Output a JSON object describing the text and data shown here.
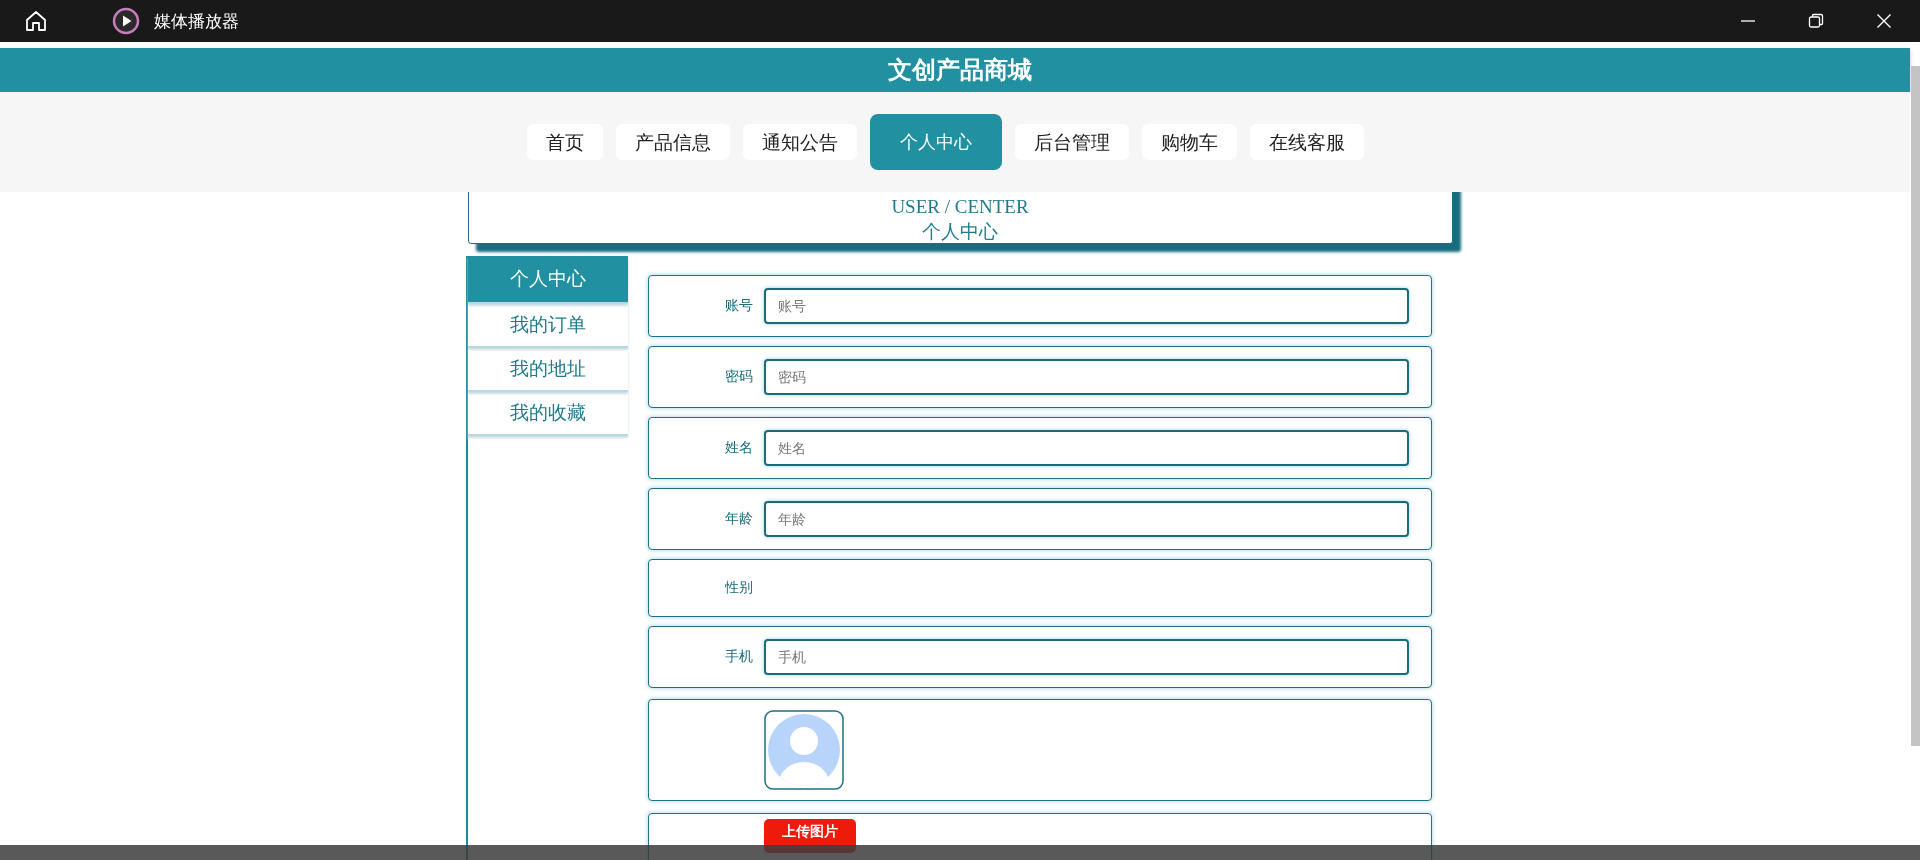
{
  "titlebar": {
    "title": "媒体播放器"
  },
  "site": {
    "title": "文创产品商城"
  },
  "nav": [
    {
      "label": "首页",
      "selected": false
    },
    {
      "label": "产品信息",
      "selected": false
    },
    {
      "label": "通知公告",
      "selected": false
    },
    {
      "label": "个人中心",
      "selected": true
    },
    {
      "label": "后台管理",
      "selected": false
    },
    {
      "label": "购物车",
      "selected": false
    },
    {
      "label": "在线客服",
      "selected": false
    }
  ],
  "banner": {
    "english": "USER / CENTER",
    "title": "个人中心"
  },
  "side_menu": [
    {
      "label": "个人中心",
      "selected": true
    },
    {
      "label": "我的订单",
      "selected": false
    },
    {
      "label": "我的地址",
      "selected": false
    },
    {
      "label": "我的收藏",
      "selected": false
    }
  ],
  "form": [
    {
      "kind": "text",
      "label": "账号",
      "placeholder": "账号"
    },
    {
      "kind": "text",
      "label": "密码",
      "placeholder": "密码"
    },
    {
      "kind": "text",
      "label": "姓名",
      "placeholder": "姓名"
    },
    {
      "kind": "text",
      "label": "年龄",
      "placeholder": "年龄"
    },
    {
      "kind": "choice",
      "label": "性别"
    },
    {
      "kind": "text",
      "label": "手机",
      "placeholder": "手机"
    },
    {
      "kind": "image"
    },
    {
      "kind": "upload",
      "button": "上传图片"
    }
  ]
}
